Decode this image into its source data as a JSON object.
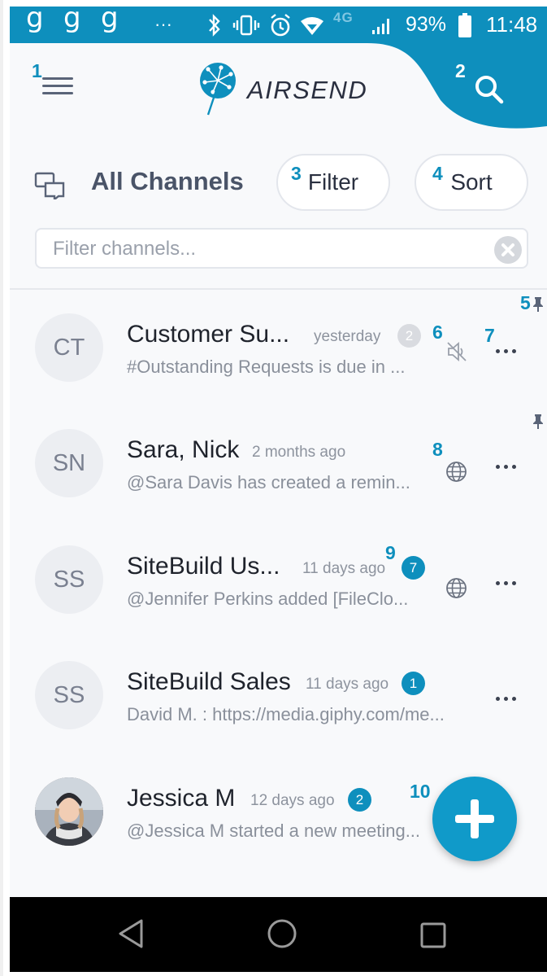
{
  "status_bar": {
    "left_glyphs": [
      "g",
      "g",
      "g"
    ],
    "more": "···",
    "network": "4G",
    "battery": "93%",
    "time": "11:48"
  },
  "header": {
    "menu_annotation": "1",
    "search_annotation": "2",
    "logo_text": "AIRSEND",
    "accent_color": "#0e8fbd"
  },
  "channels_bar": {
    "title": "All Channels",
    "filter_label": "Filter",
    "filter_annotation": "3",
    "sort_label": "Sort",
    "sort_annotation": "4"
  },
  "filter_input": {
    "placeholder": "Filter channels...",
    "value": ""
  },
  "channels": [
    {
      "initials": "CT",
      "name": "Customer Su...",
      "time": "yesterday",
      "badge": "2",
      "message": "#Outstanding Requests is due in ...",
      "pin_annotation": "5",
      "mute_annotation": "6",
      "more_annotation": "7"
    },
    {
      "initials": "SN",
      "name": "Sara, Nick",
      "time": "2 months ago",
      "message": "@Sara Davis has created a remin...",
      "globe_annotation": "8"
    },
    {
      "initials": "SS",
      "name": "SiteBuild Us...",
      "time": "11 days ago",
      "badge": "7",
      "badge_annotation": "9",
      "message": "@Jennifer Perkins added [FileClo..."
    },
    {
      "initials": "SS",
      "name": "SiteBuild Sales",
      "time": "11 days ago",
      "badge": "1",
      "message": "David M. : https://media.giphy.com/me..."
    },
    {
      "name": "Jessica M",
      "time": "12 days ago",
      "badge": "2",
      "message": "@Jessica M started a new meeting..."
    }
  ],
  "fab": {
    "annotation": "10",
    "icon": "plus-icon"
  },
  "nav_icons": [
    "back-icon",
    "home-icon",
    "recents-icon"
  ]
}
